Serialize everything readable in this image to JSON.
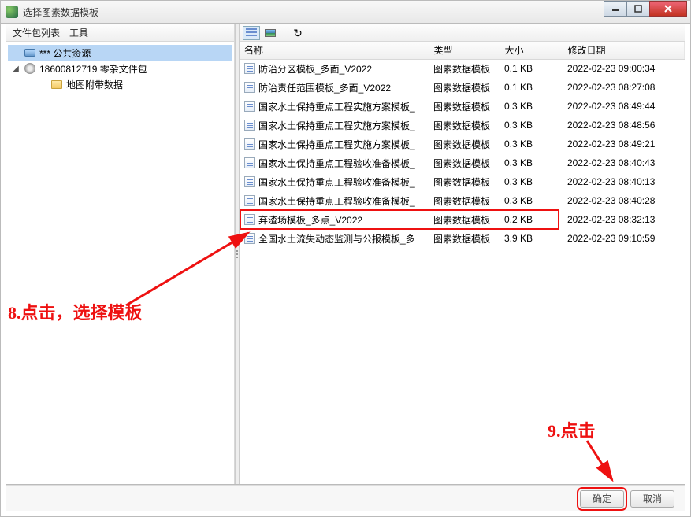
{
  "window": {
    "title": "选择图素数据模板"
  },
  "left": {
    "menu": {
      "pkg_list": "文件包列表",
      "tools": "工具"
    },
    "tree": [
      {
        "label": "*** 公共资源",
        "icon": "monitor",
        "selected": true,
        "indent": 0,
        "expander": ""
      },
      {
        "label": "18600812719 零杂文件包",
        "icon": "disc",
        "selected": false,
        "indent": 0,
        "expander": "◢"
      },
      {
        "label": "地图附带数据",
        "icon": "folder",
        "selected": false,
        "indent": 1,
        "expander": ""
      }
    ]
  },
  "table": {
    "headers": {
      "name": "名称",
      "type": "类型",
      "size": "大小",
      "mtime": "修改日期"
    },
    "rows": [
      {
        "name": "防治分区模板_多面_V2022",
        "type": "图素数据模板",
        "size": "0.1 KB",
        "mtime": "2022-02-23 09:00:34"
      },
      {
        "name": "防治责任范围模板_多面_V2022",
        "type": "图素数据模板",
        "size": "0.1 KB",
        "mtime": "2022-02-23 08:27:08"
      },
      {
        "name": "国家水土保持重点工程实施方案模板_",
        "type": "图素数据模板",
        "size": "0.3 KB",
        "mtime": "2022-02-23 08:49:44"
      },
      {
        "name": "国家水土保持重点工程实施方案模板_",
        "type": "图素数据模板",
        "size": "0.3 KB",
        "mtime": "2022-02-23 08:48:56"
      },
      {
        "name": "国家水土保持重点工程实施方案模板_",
        "type": "图素数据模板",
        "size": "0.3 KB",
        "mtime": "2022-02-23 08:49:21"
      },
      {
        "name": "国家水土保持重点工程验收准备模板_",
        "type": "图素数据模板",
        "size": "0.3 KB",
        "mtime": "2022-02-23 08:40:43"
      },
      {
        "name": "国家水土保持重点工程验收准备模板_",
        "type": "图素数据模板",
        "size": "0.3 KB",
        "mtime": "2022-02-23 08:40:13"
      },
      {
        "name": "国家水土保持重点工程验收准备模板_",
        "type": "图素数据模板",
        "size": "0.3 KB",
        "mtime": "2022-02-23 08:40:28"
      },
      {
        "name": "弃渣场模板_多点_V2022",
        "type": "图素数据模板",
        "size": "0.2 KB",
        "mtime": "2022-02-23 08:32:13"
      },
      {
        "name": "全国水土流失动态监测与公报模板_多",
        "type": "图素数据模板",
        "size": "3.9 KB",
        "mtime": "2022-02-23 09:10:59"
      }
    ],
    "highlight_index": 8
  },
  "footer": {
    "ok": "确定",
    "cancel": "取消"
  },
  "annotations": {
    "step8": "8.点击，选择模板",
    "step9": "9.点击"
  }
}
